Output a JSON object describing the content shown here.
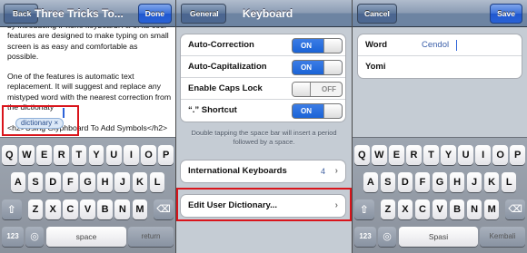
{
  "panel1": {
    "back_label": "Back",
    "title": "Three Tricks To...",
    "done_label": "Done",
    "doc_lines": [
      "by introducing iPhone keyboard. All of its cool",
      "features are designed to make typing on small",
      "screen is as easy and comfortable as",
      "possible."
    ],
    "para2": [
      "One of the features is automatic text",
      "replacement. It will suggest and replace any",
      "mistyped word with the nearest correction from",
      "the dictionaty"
    ],
    "tail_line": "<h2>Using Glyphboard To Add Symbols</h2>",
    "suggestion": "dictionary",
    "suggestion_close": "×",
    "keyboard": {
      "row1": [
        "Q",
        "W",
        "E",
        "R",
        "T",
        "Y",
        "U",
        "I",
        "O",
        "P"
      ],
      "row2": [
        "A",
        "S",
        "D",
        "F",
        "G",
        "H",
        "J",
        "K",
        "L"
      ],
      "row3": [
        "Z",
        "X",
        "C",
        "V",
        "B",
        "N",
        "M"
      ],
      "num_key": "123",
      "space_label": "space",
      "return_label": "return",
      "shift_icon": "shift-arrow",
      "globe_icon": "globe",
      "delete_icon": "backspace"
    }
  },
  "panel2": {
    "back_label": "General",
    "title": "Keyboard",
    "toggles": [
      {
        "label": "Auto-Correction",
        "state": "ON"
      },
      {
        "label": "Auto-Capitalization",
        "state": "ON"
      },
      {
        "label": "Enable Caps Lock",
        "state": "OFF"
      },
      {
        "label": "“.” Shortcut",
        "state": "ON"
      }
    ],
    "footnote": "Double tapping the space bar will insert a period followed by a space.",
    "intl_label": "International Keyboards",
    "intl_count": "4",
    "edit_label": "Edit User Dictionary...",
    "chevron": "›"
  },
  "panel3": {
    "cancel_label": "Cancel",
    "save_label": "Save",
    "word_label": "Word",
    "word_value": "Cendol",
    "yomi_label": "Yomi",
    "keyboard": {
      "row1": [
        "Q",
        "W",
        "E",
        "R",
        "T",
        "Y",
        "U",
        "I",
        "O",
        "P"
      ],
      "row2": [
        "A",
        "S",
        "D",
        "F",
        "G",
        "H",
        "J",
        "K",
        "L"
      ],
      "row3": [
        "Z",
        "X",
        "C",
        "V",
        "B",
        "N",
        "M"
      ],
      "num_key": "123",
      "space_label": "Spasi",
      "return_label": "Kembali"
    }
  },
  "colors": {
    "highlight": "#d9141b",
    "toggle_on": "#1a63d6",
    "nav": "#6d84a2"
  }
}
